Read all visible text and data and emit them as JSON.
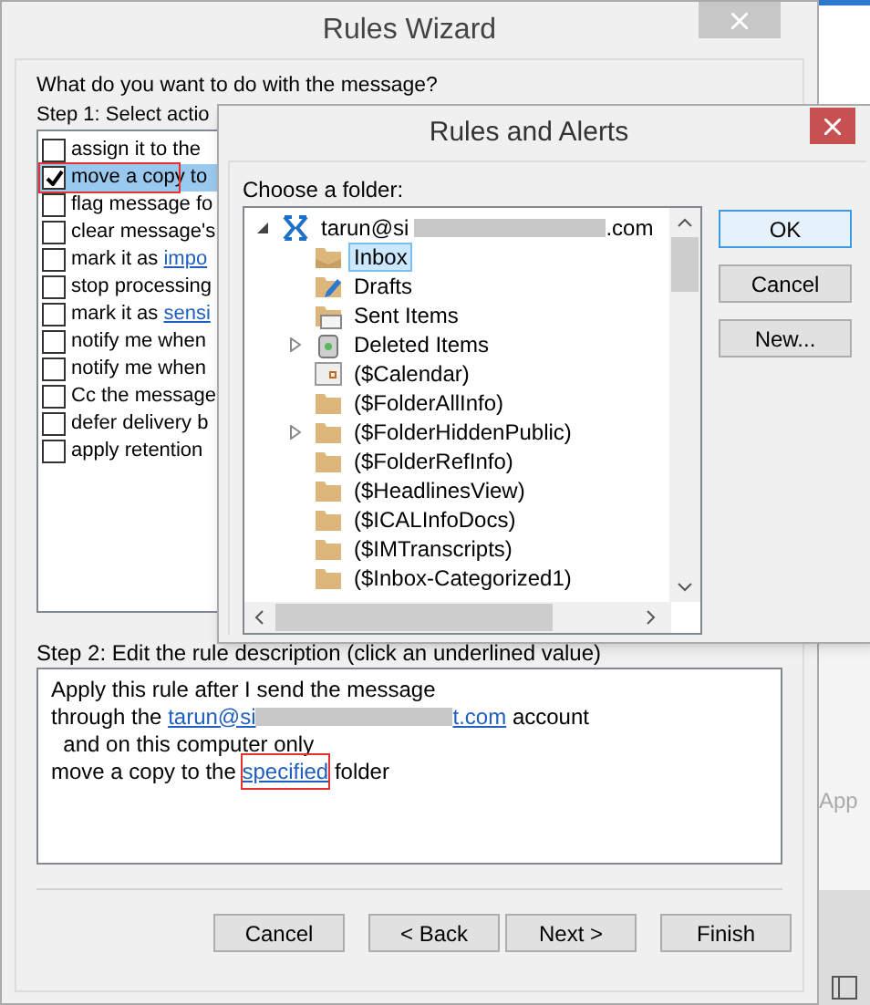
{
  "wizard": {
    "title": "Rules Wizard",
    "question": "What do you want to do with the message?",
    "step1": "Step 1: Select actio",
    "actions": [
      {
        "label": "assign it to the",
        "checked": false,
        "selected": false
      },
      {
        "label": "move a copy to",
        "checked": true,
        "selected": true,
        "annotated": true
      },
      {
        "label": "flag message fo",
        "checked": false,
        "selected": false
      },
      {
        "label": "clear message's",
        "checked": false,
        "selected": false
      },
      {
        "label": "mark it as ",
        "link": "impo",
        "checked": false,
        "selected": false
      },
      {
        "label": "stop processing",
        "checked": false,
        "selected": false
      },
      {
        "label": "mark it as ",
        "link": "sensi",
        "checked": false,
        "selected": false
      },
      {
        "label": "notify me when",
        "checked": false,
        "selected": false
      },
      {
        "label": "notify me when",
        "checked": false,
        "selected": false
      },
      {
        "label": "Cc the message",
        "checked": false,
        "selected": false
      },
      {
        "label": "defer delivery b",
        "checked": false,
        "selected": false
      },
      {
        "label": "apply retention",
        "checked": false,
        "selected": false
      }
    ],
    "step2": "Step 2: Edit the rule description (click an underlined value)",
    "description": [
      [
        {
          "kind": "text",
          "text": "Apply this rule after I send the message"
        }
      ],
      [
        {
          "kind": "text",
          "text": "through the "
        },
        {
          "kind": "link",
          "text": "tarun@si"
        },
        {
          "kind": "redacted"
        },
        {
          "kind": "link",
          "text": "t.com"
        },
        {
          "kind": "text",
          "text": " account"
        }
      ],
      [
        {
          "kind": "text",
          "text": "  and on this computer only"
        }
      ],
      [
        {
          "kind": "text",
          "text": "move a copy to the "
        },
        {
          "kind": "link",
          "text": "specified",
          "annotated": true
        },
        {
          "kind": "text",
          "text": " folder"
        }
      ]
    ],
    "buttons": [
      "Cancel",
      "< Back",
      "Next >",
      "Finish"
    ]
  },
  "dialog": {
    "title": "Rules and Alerts",
    "prompt": "Choose a folder:",
    "tree": [
      {
        "label": "tarun@si",
        "suffix": ".com",
        "kind": "account",
        "expanded": true,
        "selected": false,
        "children": [
          {
            "label": "Inbox",
            "kind": "inbox",
            "selected": true
          },
          {
            "label": "Drafts",
            "kind": "drafts",
            "selected": false
          },
          {
            "label": "Sent Items",
            "kind": "sent",
            "selected": false
          },
          {
            "label": "Deleted Items",
            "kind": "deleted",
            "expanded": false,
            "selected": false
          },
          {
            "label": "($Calendar)",
            "kind": "calendar",
            "selected": false
          },
          {
            "label": "($FolderAllInfo)",
            "kind": "folder",
            "selected": false
          },
          {
            "label": "($FolderHiddenPublic)",
            "kind": "folder",
            "expanded": false,
            "selected": false
          },
          {
            "label": "($FolderRefInfo)",
            "kind": "folder",
            "selected": false
          },
          {
            "label": "($HeadlinesView)",
            "kind": "folder",
            "selected": false
          },
          {
            "label": "($ICALInfoDocs)",
            "kind": "folder",
            "selected": false
          },
          {
            "label": "($IMTranscripts)",
            "kind": "folder",
            "selected": false
          },
          {
            "label": "($Inbox-Categorized1)",
            "kind": "folder",
            "selected": false
          }
        ]
      }
    ],
    "buttons": [
      {
        "label": "OK",
        "default": true
      },
      {
        "label": "Cancel",
        "default": false
      },
      {
        "label": "New...",
        "default": false
      }
    ]
  },
  "background": {
    "button": "App"
  }
}
